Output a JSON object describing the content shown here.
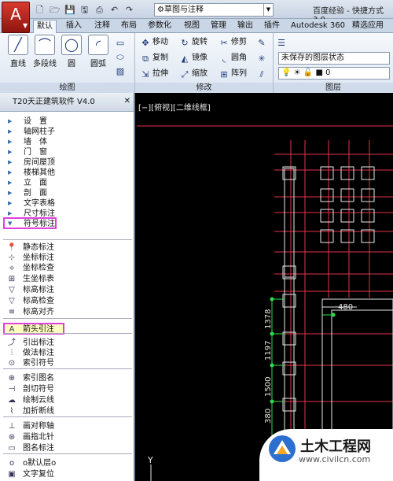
{
  "app": {
    "button_glyph": "A",
    "workspace": "草图与注释",
    "window_title": "百度经验 - 快捷方式 3.0"
  },
  "ribbon_tabs": [
    "默认",
    "插入",
    "注释",
    "布局",
    "参数化",
    "视图",
    "管理",
    "输出",
    "插件",
    "Autodesk 360",
    "精选应用"
  ],
  "draw": {
    "line": "直线",
    "polyline": "多段线",
    "circle": "圆",
    "arc": "圆弧",
    "panel": "绘图"
  },
  "modify": {
    "move": "移动",
    "rotate": "旋转",
    "trim": "修剪",
    "copy": "复制",
    "mirror": "镜像",
    "fillet": "圆角",
    "stretch": "拉伸",
    "scale": "缩放",
    "array": "阵列",
    "panel": "修改"
  },
  "layers": {
    "state": "未保存的图层状态",
    "current": "0",
    "panel": "图层"
  },
  "left_panel": {
    "title": "T20天正建筑软件 V4.0",
    "categories": [
      "设　置",
      "轴网柱子",
      "墙　体",
      "门　窗",
      "房间屋顶",
      "楼梯其他",
      "立　面",
      "剖　面",
      "文字表格",
      "尺寸标注",
      "符号标注"
    ],
    "sub_items": [
      "静态标注",
      "坐标标注",
      "坐标检查",
      "生坐标表",
      "标高标注",
      "标高检查",
      "标高对齐",
      "箭头引注",
      "引出标注",
      "做法标注",
      "索引符号",
      "索引图名",
      "剖切符号",
      "绘制云线",
      "加折断线",
      "画对称轴",
      "画指北针",
      "图名标注",
      "o默认层o",
      "文字复位"
    ]
  },
  "viewport": {
    "label": "[−][俯视][二维线框]",
    "dim_480": "480",
    "dim_1378": "1378",
    "dim_1197": "1197",
    "dim_1500": "1500",
    "dim_380": "380",
    "ucs_y": "Y"
  },
  "logo": {
    "name": "土木工程网",
    "url": "www.civilcn.com"
  }
}
